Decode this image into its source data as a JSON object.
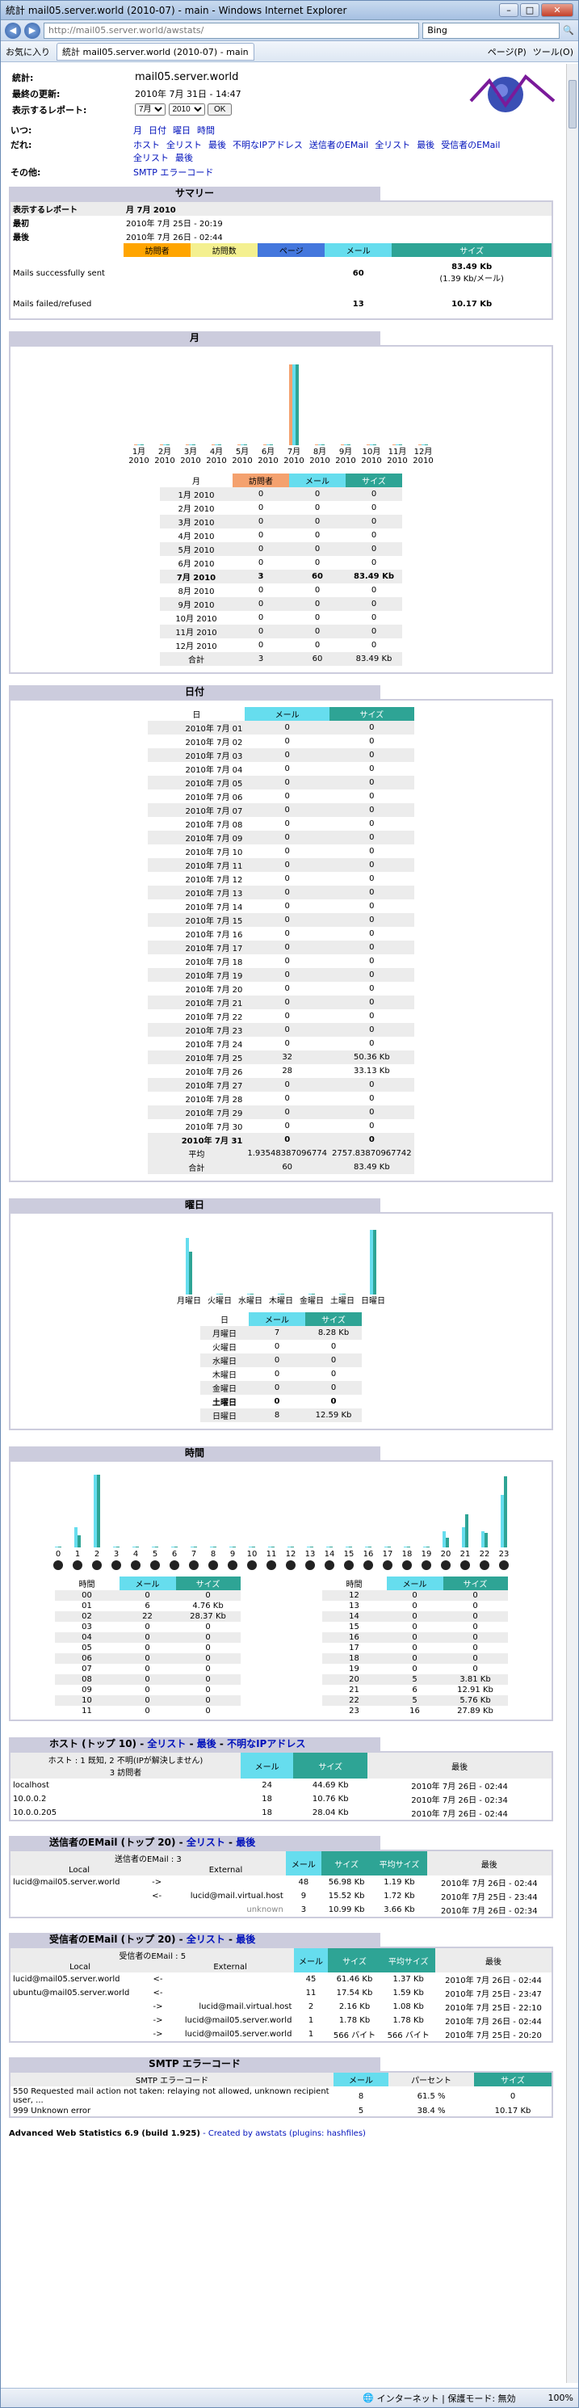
{
  "window": {
    "title": "統計 mail05.server.world (2010-07) - main - Windows Internet Explorer",
    "url": "http://mail05.server.world/awstats/",
    "search": "Bing",
    "favorites": "お気に入り",
    "tab": "統計 mail05.server.world (2010-07) - main",
    "page_menu": "ページ(P)",
    "tools_menu": "ツール(O)"
  },
  "status": {
    "zone": "インターネット | 保護モード: 無効",
    "zoom": "100%"
  },
  "header": {
    "stat_label": "統計:",
    "site": "mail05.server.world",
    "updated_label": "最終の更新:",
    "updated": "2010年 7月 31日 - 14:47",
    "report_label": "表示するレポート:",
    "month": "7月",
    "year": "2010",
    "ok": "OK"
  },
  "nav": {
    "when_label": "いつ:",
    "who_label": "だれ:",
    "other_label": "その他:",
    "when": [
      "月",
      "日付",
      "曜日",
      "時間"
    ],
    "who1": [
      "ホスト",
      "全リスト",
      "最後",
      "不明なIPアドレス",
      "送信者のEMail",
      "全リスト",
      "最後",
      "受信者のEMail"
    ],
    "who2": [
      "全リスト",
      "最後"
    ],
    "other": [
      "SMTP エラーコード"
    ]
  },
  "summary": {
    "title": "サマリー",
    "report_label": "表示するレポート",
    "report_value": "月 7月 2010",
    "first_label": "最初",
    "first_value": "2010年 7月 25日 - 20:19",
    "last_label": "最後",
    "last_value": "2010年 7月 26日 - 02:44",
    "cols": [
      "訪問者",
      "訪問数",
      "ページ",
      "メール",
      "サイズ"
    ],
    "rows": [
      {
        "label": "Mails successfully sent",
        "mail": "60",
        "size": "83.49 Kb",
        "size_sub": "(1.39 Kb/メール)"
      },
      {
        "label": "Mails failed/refused",
        "mail": "13",
        "size": "10.17 Kb"
      }
    ]
  },
  "monthly": {
    "title": "月",
    "cols": [
      "月",
      "訪問者",
      "メール",
      "サイズ"
    ],
    "rows": [
      [
        "1月 2010",
        "0",
        "0",
        "0"
      ],
      [
        "2月 2010",
        "0",
        "0",
        "0"
      ],
      [
        "3月 2010",
        "0",
        "0",
        "0"
      ],
      [
        "4月 2010",
        "0",
        "0",
        "0"
      ],
      [
        "5月 2010",
        "0",
        "0",
        "0"
      ],
      [
        "6月 2010",
        "0",
        "0",
        "0"
      ],
      [
        "7月 2010",
        "3",
        "60",
        "83.49 Kb"
      ],
      [
        "8月 2010",
        "0",
        "0",
        "0"
      ],
      [
        "9月 2010",
        "0",
        "0",
        "0"
      ],
      [
        "10月 2010",
        "0",
        "0",
        "0"
      ],
      [
        "11月 2010",
        "0",
        "0",
        "0"
      ],
      [
        "12月 2010",
        "0",
        "0",
        "0"
      ]
    ],
    "total": [
      "合計",
      "3",
      "60",
      "83.49 Kb"
    ]
  },
  "daily": {
    "title": "日付",
    "cols": [
      "日",
      "メール",
      "サイズ"
    ],
    "rows": [
      [
        "2010年 7月 01",
        "0",
        "0"
      ],
      [
        "2010年 7月 02",
        "0",
        "0"
      ],
      [
        "2010年 7月 03",
        "0",
        "0"
      ],
      [
        "2010年 7月 04",
        "0",
        "0"
      ],
      [
        "2010年 7月 05",
        "0",
        "0"
      ],
      [
        "2010年 7月 06",
        "0",
        "0"
      ],
      [
        "2010年 7月 07",
        "0",
        "0"
      ],
      [
        "2010年 7月 08",
        "0",
        "0"
      ],
      [
        "2010年 7月 09",
        "0",
        "0"
      ],
      [
        "2010年 7月 10",
        "0",
        "0"
      ],
      [
        "2010年 7月 11",
        "0",
        "0"
      ],
      [
        "2010年 7月 12",
        "0",
        "0"
      ],
      [
        "2010年 7月 13",
        "0",
        "0"
      ],
      [
        "2010年 7月 14",
        "0",
        "0"
      ],
      [
        "2010年 7月 15",
        "0",
        "0"
      ],
      [
        "2010年 7月 16",
        "0",
        "0"
      ],
      [
        "2010年 7月 17",
        "0",
        "0"
      ],
      [
        "2010年 7月 18",
        "0",
        "0"
      ],
      [
        "2010年 7月 19",
        "0",
        "0"
      ],
      [
        "2010年 7月 20",
        "0",
        "0"
      ],
      [
        "2010年 7月 21",
        "0",
        "0"
      ],
      [
        "2010年 7月 22",
        "0",
        "0"
      ],
      [
        "2010年 7月 23",
        "0",
        "0"
      ],
      [
        "2010年 7月 24",
        "0",
        "0"
      ],
      [
        "2010年 7月 25",
        "32",
        "50.36 Kb"
      ],
      [
        "2010年 7月 26",
        "28",
        "33.13 Kb"
      ],
      [
        "2010年 7月 27",
        "0",
        "0"
      ],
      [
        "2010年 7月 28",
        "0",
        "0"
      ],
      [
        "2010年 7月 29",
        "0",
        "0"
      ],
      [
        "2010年 7月 30",
        "0",
        "0"
      ],
      [
        "2010年 7月 31",
        "0",
        "0"
      ]
    ],
    "avg": [
      "平均",
      "1.93548387096774",
      "2757.83870967742"
    ],
    "total": [
      "合計",
      "60",
      "83.49 Kb"
    ]
  },
  "weekday": {
    "title": "曜日",
    "cols": [
      "日",
      "メール",
      "サイズ"
    ],
    "rows": [
      [
        "月曜日",
        "7",
        "8.28 Kb"
      ],
      [
        "火曜日",
        "0",
        "0"
      ],
      [
        "水曜日",
        "0",
        "0"
      ],
      [
        "木曜日",
        "0",
        "0"
      ],
      [
        "金曜日",
        "0",
        "0"
      ],
      [
        "土曜日",
        "0",
        "0"
      ],
      [
        "日曜日",
        "8",
        "12.59 Kb"
      ]
    ]
  },
  "hourly": {
    "title": "時間",
    "cols": [
      "時間",
      "メール",
      "サイズ"
    ],
    "left": [
      [
        "00",
        "0",
        "0"
      ],
      [
        "01",
        "6",
        "4.76 Kb"
      ],
      [
        "02",
        "22",
        "28.37 Kb"
      ],
      [
        "03",
        "0",
        "0"
      ],
      [
        "04",
        "0",
        "0"
      ],
      [
        "05",
        "0",
        "0"
      ],
      [
        "06",
        "0",
        "0"
      ],
      [
        "07",
        "0",
        "0"
      ],
      [
        "08",
        "0",
        "0"
      ],
      [
        "09",
        "0",
        "0"
      ],
      [
        "10",
        "0",
        "0"
      ],
      [
        "11",
        "0",
        "0"
      ]
    ],
    "right": [
      [
        "12",
        "0",
        "0"
      ],
      [
        "13",
        "0",
        "0"
      ],
      [
        "14",
        "0",
        "0"
      ],
      [
        "15",
        "0",
        "0"
      ],
      [
        "16",
        "0",
        "0"
      ],
      [
        "17",
        "0",
        "0"
      ],
      [
        "18",
        "0",
        "0"
      ],
      [
        "19",
        "0",
        "0"
      ],
      [
        "20",
        "5",
        "3.81 Kb"
      ],
      [
        "21",
        "6",
        "12.91 Kb"
      ],
      [
        "22",
        "5",
        "5.76 Kb"
      ],
      [
        "23",
        "16",
        "27.89 Kb"
      ]
    ]
  },
  "hosts": {
    "title": "ホスト (トップ 10)",
    "links": [
      "全リスト",
      "最後",
      "不明なIPアドレス"
    ],
    "info": "ホスト : 1 既知, 2 不明(IPが解決しません)",
    "info2": "3 訪問者",
    "cols": [
      "メール",
      "サイズ",
      "最後"
    ],
    "rows": [
      [
        "localhost",
        "24",
        "44.69 Kb",
        "2010年 7月 26日 - 02:44"
      ],
      [
        "10.0.0.2",
        "18",
        "10.76 Kb",
        "2010年 7月 26日 - 02:34"
      ],
      [
        "10.0.0.205",
        "18",
        "28.04 Kb",
        "2010年 7月 26日 - 02:44"
      ]
    ]
  },
  "senders": {
    "title": "送信者のEMail (トップ 20)",
    "links": [
      "全リスト",
      "最後"
    ],
    "info": "送信者のEMail : 3",
    "cols": [
      "Local",
      "External",
      "メール",
      "サイズ",
      "平均サイズ",
      "最後"
    ],
    "rows": [
      [
        "lucid@mail05.server.world",
        "->",
        "",
        "48",
        "56.98 Kb",
        "1.19 Kb",
        "2010年 7月 26日 - 02:44"
      ],
      [
        "",
        "<-",
        "lucid@mail.virtual.host",
        "9",
        "15.52 Kb",
        "1.72 Kb",
        "2010年 7月 25日 - 23:44"
      ],
      [
        "",
        "",
        "unknown",
        "3",
        "10.99 Kb",
        "3.66 Kb",
        "2010年 7月 26日 - 02:34"
      ]
    ]
  },
  "receivers": {
    "title": "受信者のEMail (トップ 20)",
    "links": [
      "全リスト",
      "最後"
    ],
    "info": "受信者のEMail : 5",
    "cols": [
      "Local",
      "External",
      "メール",
      "サイズ",
      "平均サイズ",
      "最後"
    ],
    "rows": [
      [
        "lucid@mail05.server.world",
        "<-",
        "",
        "45",
        "61.46 Kb",
        "1.37 Kb",
        "2010年 7月 26日 - 02:44"
      ],
      [
        "ubuntu@mail05.server.world",
        "<-",
        "",
        "11",
        "17.54 Kb",
        "1.59 Kb",
        "2010年 7月 25日 - 23:47"
      ],
      [
        "",
        "->",
        "lucid@mail.virtual.host",
        "2",
        "2.16 Kb",
        "1.08 Kb",
        "2010年 7月 25日 - 22:10"
      ],
      [
        "",
        "->",
        "lucid@mail05.server.world",
        "1",
        "1.78 Kb",
        "1.78 Kb",
        "2010年 7月 26日 - 02:44"
      ],
      [
        "",
        "->",
        "lucid@mail05.server.world",
        "1",
        "566 バイト",
        "566 バイト",
        "2010年 7月 25日 - 20:20"
      ]
    ]
  },
  "smtp": {
    "title": "SMTP エラーコード",
    "cols": [
      "SMTP エラーコード",
      "メール",
      "パーセント",
      "サイズ"
    ],
    "rows": [
      [
        "550 Requested mail action not taken: relaying not allowed, unknown recipient user, ...",
        "8",
        "61.5 %",
        "0"
      ],
      [
        "999 Unknown error",
        "5",
        "38.4 %",
        "10.17 Kb"
      ]
    ]
  },
  "footer": {
    "text": "Advanced Web Statistics 6.9 (build 1.925)",
    "credit": "- Created by awstats (plugins: hashfiles)"
  },
  "chart_data": [
    {
      "type": "bar",
      "categories": [
        "1月 2010",
        "2月 2010",
        "3月 2010",
        "4月 2010",
        "5月 2010",
        "6月 2010",
        "7月 2010",
        "8月 2010",
        "9月 2010",
        "10月 2010",
        "11月 2010",
        "12月 2010"
      ],
      "series": [
        {
          "name": "訪問者",
          "values": [
            0,
            0,
            0,
            0,
            0,
            0,
            3,
            0,
            0,
            0,
            0,
            0
          ]
        },
        {
          "name": "メール",
          "values": [
            0,
            0,
            0,
            0,
            0,
            0,
            60,
            0,
            0,
            0,
            0,
            0
          ]
        },
        {
          "name": "サイズ",
          "values": [
            0,
            0,
            0,
            0,
            0,
            0,
            83.49,
            0,
            0,
            0,
            0,
            0
          ]
        }
      ]
    },
    {
      "type": "bar",
      "categories": [
        "01",
        "02",
        "03",
        "04",
        "05",
        "06",
        "07",
        "08",
        "09",
        "10",
        "11",
        "12",
        "13",
        "14",
        "15",
        "16",
        "17",
        "18",
        "19",
        "20",
        "21",
        "22",
        "23",
        "24",
        "25",
        "26",
        "27",
        "28",
        "29",
        "30",
        "31"
      ],
      "series": [
        {
          "name": "メール",
          "values": [
            0,
            0,
            0,
            0,
            0,
            0,
            0,
            0,
            0,
            0,
            0,
            0,
            0,
            0,
            0,
            0,
            0,
            0,
            0,
            0,
            0,
            0,
            0,
            0,
            32,
            28,
            0,
            0,
            0,
            0,
            0
          ]
        },
        {
          "name": "サイズ",
          "values": [
            0,
            0,
            0,
            0,
            0,
            0,
            0,
            0,
            0,
            0,
            0,
            0,
            0,
            0,
            0,
            0,
            0,
            0,
            0,
            0,
            0,
            0,
            0,
            0,
            50.36,
            33.13,
            0,
            0,
            0,
            0,
            0
          ]
        }
      ]
    },
    {
      "type": "bar",
      "categories": [
        "月曜日",
        "火曜日",
        "水曜日",
        "木曜日",
        "金曜日",
        "土曜日",
        "日曜日"
      ],
      "series": [
        {
          "name": "メール",
          "values": [
            7,
            0,
            0,
            0,
            0,
            0,
            8
          ]
        },
        {
          "name": "サイズ",
          "values": [
            8.28,
            0,
            0,
            0,
            0,
            0,
            12.59
          ]
        }
      ]
    },
    {
      "type": "bar",
      "categories": [
        "0",
        "1",
        "2",
        "3",
        "4",
        "5",
        "6",
        "7",
        "8",
        "9",
        "10",
        "11",
        "12",
        "13",
        "14",
        "15",
        "16",
        "17",
        "18",
        "19",
        "20",
        "21",
        "22",
        "23"
      ],
      "series": [
        {
          "name": "メール",
          "values": [
            0,
            6,
            22,
            0,
            0,
            0,
            0,
            0,
            0,
            0,
            0,
            0,
            0,
            0,
            0,
            0,
            0,
            0,
            0,
            0,
            5,
            6,
            5,
            16
          ]
        },
        {
          "name": "サイズ",
          "values": [
            0,
            4.76,
            28.37,
            0,
            0,
            0,
            0,
            0,
            0,
            0,
            0,
            0,
            0,
            0,
            0,
            0,
            0,
            0,
            0,
            0,
            3.81,
            12.91,
            5.76,
            27.89
          ]
        }
      ]
    }
  ]
}
